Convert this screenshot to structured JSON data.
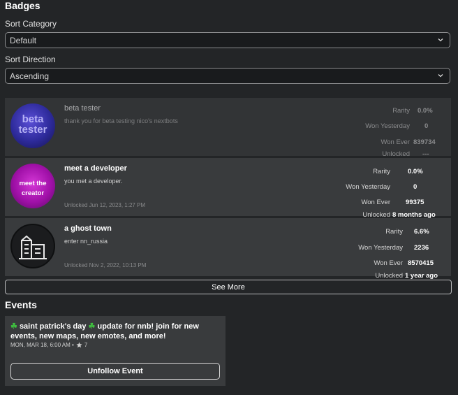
{
  "badges_section": {
    "title": "Badges",
    "sort_category": {
      "label": "Sort Category",
      "value": "Default"
    },
    "sort_direction": {
      "label": "Sort Direction",
      "value": "Ascending"
    },
    "stat_labels": {
      "rarity": "Rarity",
      "won_yesterday": "Won Yesterday",
      "won_ever": "Won Ever",
      "unlocked": "Unlocked"
    },
    "items": [
      {
        "icon_text_1": "beta",
        "icon_text_2": "tester",
        "name": "beta tester",
        "description": "thank you for beta testing nico's nextbots",
        "unlocked_date": "",
        "rarity": "0.0%",
        "won_yesterday": "0",
        "won_ever": "839734",
        "unlocked": "---"
      },
      {
        "icon_text_1": "meet the",
        "icon_text_2": "creator",
        "name": "meet a developer",
        "description": "you met a developer.",
        "unlocked_date": "Unlocked Jun 12, 2023, 1:27 PM",
        "rarity": "0.0%",
        "won_yesterday": "0",
        "won_ever": "99375",
        "unlocked": "8 months ago"
      },
      {
        "icon": "building-icon",
        "name": "a ghost town",
        "description": "enter nn_russia",
        "unlocked_date": "Unlocked Nov 2, 2022, 10:13 PM",
        "rarity": "6.6%",
        "won_yesterday": "2236",
        "won_ever": "8570415",
        "unlocked": "1 year ago"
      }
    ],
    "see_more": "See More"
  },
  "events_section": {
    "title": "Events",
    "event": {
      "title_emoji": "☘",
      "title_part1": "saint patrick's day",
      "title_part2": "update for nnb! join for new events, new maps, new emotes, and more!",
      "date": "MON, MAR 18, 6:00 AM •",
      "star_count": "7",
      "unfollow_label": "Unfollow Event"
    }
  },
  "colors": {
    "background": "#232527",
    "card": "#393b3d",
    "clover": "#3fbf3f"
  }
}
